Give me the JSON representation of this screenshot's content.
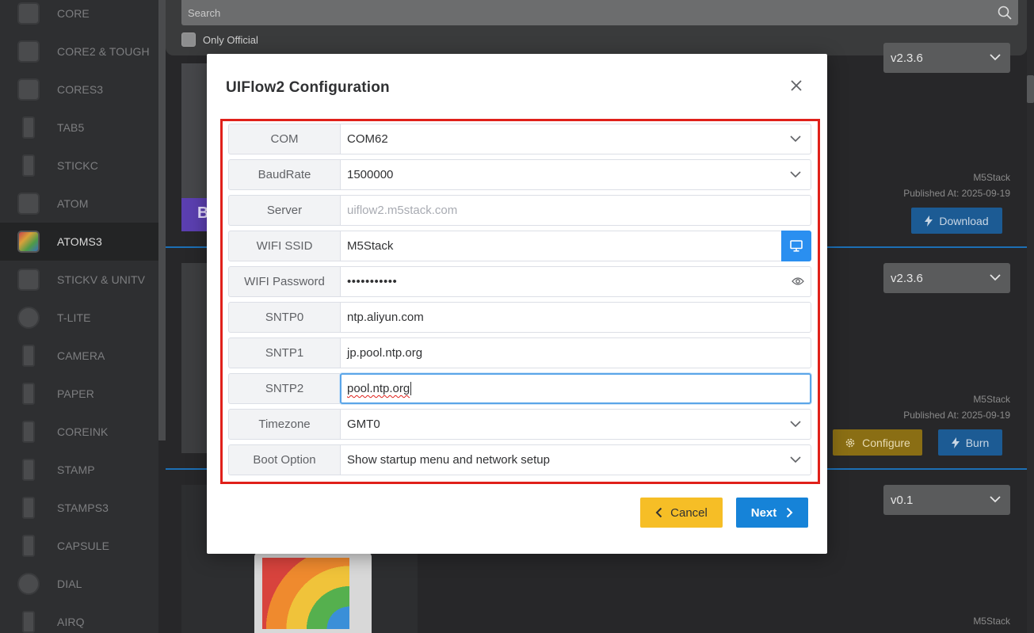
{
  "sidebar": {
    "items": [
      {
        "label": "CORE"
      },
      {
        "label": "CORE2 & TOUGH"
      },
      {
        "label": "CORES3"
      },
      {
        "label": "TAB5"
      },
      {
        "label": "STICKC"
      },
      {
        "label": "ATOM"
      },
      {
        "label": "ATOMS3",
        "active": true
      },
      {
        "label": "STICKV & UNITV"
      },
      {
        "label": "T-LITE"
      },
      {
        "label": "CAMERA"
      },
      {
        "label": "PAPER"
      },
      {
        "label": "COREINK"
      },
      {
        "label": "STAMP"
      },
      {
        "label": "STAMPS3"
      },
      {
        "label": "CAPSULE"
      },
      {
        "label": "DIAL"
      },
      {
        "label": "AIRQ"
      }
    ]
  },
  "search": {
    "placeholder": "Search",
    "only_official_label": "Only Official"
  },
  "firmware": [
    {
      "version": "v2.3.6",
      "author": "M5Stack",
      "published": "Published At: 2025-09-19",
      "download_label": "Download"
    },
    {
      "version": "v2.3.6",
      "author": "M5Stack",
      "published": "Published At: 2025-09-19",
      "configure_label": "Configure",
      "burn_label": "Burn"
    },
    {
      "version": "v0.1",
      "author": "M5Stack"
    }
  ],
  "modal": {
    "title": "UIFlow2 Configuration",
    "fields": {
      "com": {
        "label": "COM",
        "value": "COM62"
      },
      "baud": {
        "label": "BaudRate",
        "value": "1500000"
      },
      "server": {
        "label": "Server",
        "value": "uiflow2.m5stack.com"
      },
      "ssid": {
        "label": "WIFI SSID",
        "value": "M5Stack"
      },
      "password": {
        "label": "WIFI Password",
        "value": "•••••••••••"
      },
      "sntp0": {
        "label": "SNTP0",
        "value": "ntp.aliyun.com"
      },
      "sntp1": {
        "label": "SNTP1",
        "value": "jp.pool.ntp.org"
      },
      "sntp2": {
        "label": "SNTP2",
        "value": "pool.ntp.org"
      },
      "timezone": {
        "label": "Timezone",
        "value": "GMT0"
      },
      "boot": {
        "label": "Boot Option",
        "value": "Show startup menu and network setup"
      }
    },
    "cancel_label": "Cancel",
    "next_label": "Next"
  },
  "colors": {
    "accent_blue": "#1683d8",
    "cancel_yellow": "#f6be26",
    "highlight_red": "#e0201a"
  }
}
